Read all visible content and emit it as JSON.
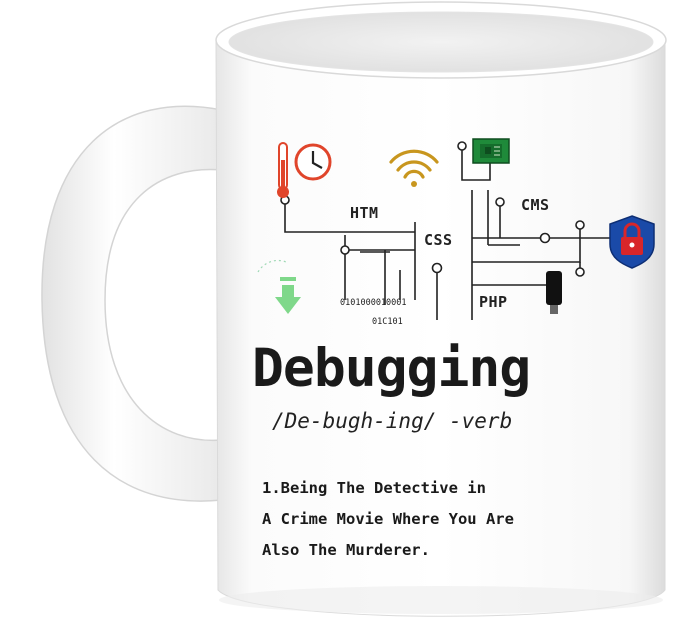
{
  "mug": {
    "body_color": "#ffffff",
    "shadow_color": "#d9d9d9"
  },
  "print": {
    "circuit_labels": {
      "htm": "HTM",
      "css": "CSS",
      "cms": "CMS",
      "php": "PHP"
    },
    "binary_line1": "0101000010001",
    "binary_line2": "01C101",
    "title": "Debugging",
    "pronunciation": "/De-bugh-ing/ -verb",
    "definition_lines": [
      "1.Being The Detective in",
      "A Crime Movie Where You Are",
      "Also The Murderer."
    ]
  },
  "icons": [
    "thermometer-clock-icon",
    "wifi-icon",
    "chip-icon",
    "lock-shield-icon",
    "usb-drive-icon",
    "download-arrow-icon"
  ],
  "colors": {
    "clock_red": "#e0452b",
    "wifi_gold": "#c8961e",
    "chip_green": "#1f8a3a",
    "shield_blue": "#1a4aa8",
    "lock_red": "#d8262a",
    "arrow_green": "#7fd88a"
  }
}
